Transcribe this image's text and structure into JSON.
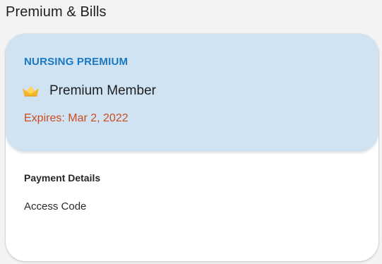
{
  "page": {
    "title": "Premium & Bills"
  },
  "premium": {
    "eyebrow": "NURSING PREMIUM",
    "icon": "crown-icon",
    "member_label": "Premium Member",
    "expires": "Expires: Mar 2, 2022"
  },
  "payment": {
    "heading": "Payment Details",
    "access_code_label": "Access Code"
  },
  "colors": {
    "accent_blue": "#1a78c2",
    "panel_blue": "#d0e3f3",
    "expiry_red": "#cc4c1e",
    "crown_gold": "#f4b72b"
  }
}
